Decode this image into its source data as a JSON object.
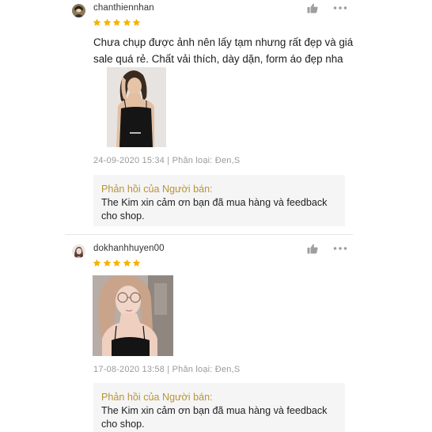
{
  "reviews": [
    {
      "username": "chanthiennhan",
      "rating": 5,
      "comment": "Chưa chụp được ảnh nên lấy tạm nhưng rất đẹp và giá sale quá rẻ. Chất vải thích, dày dặn, form áo đẹp nha",
      "meta": "24-09-2020 15:34 | Phân loại: Đen,S",
      "seller_reply_title": "Phản hồi của Người bán:",
      "seller_reply_text": "The Kim xin cảm ơn bạn đã mua hàng và feedback cho shop."
    },
    {
      "username": "dokhanhhuyen00",
      "rating": 5,
      "comment": "",
      "meta": "17-08-2020 13:58 | Phân loại: Đen,S",
      "seller_reply_title": "Phản hồi của Người bán:",
      "seller_reply_text": "The Kim xin cảm ơn bạn đã mua hàng và feedback cho shop."
    }
  ],
  "icons": {
    "like": "thumbs-up-icon",
    "more": "more-dots-icon",
    "star": "star-icon"
  },
  "colors": {
    "star": "#f5b301",
    "reply_title": "#b8933a",
    "reply_bg": "#f5f5f5",
    "meta": "#9a9a9a"
  }
}
